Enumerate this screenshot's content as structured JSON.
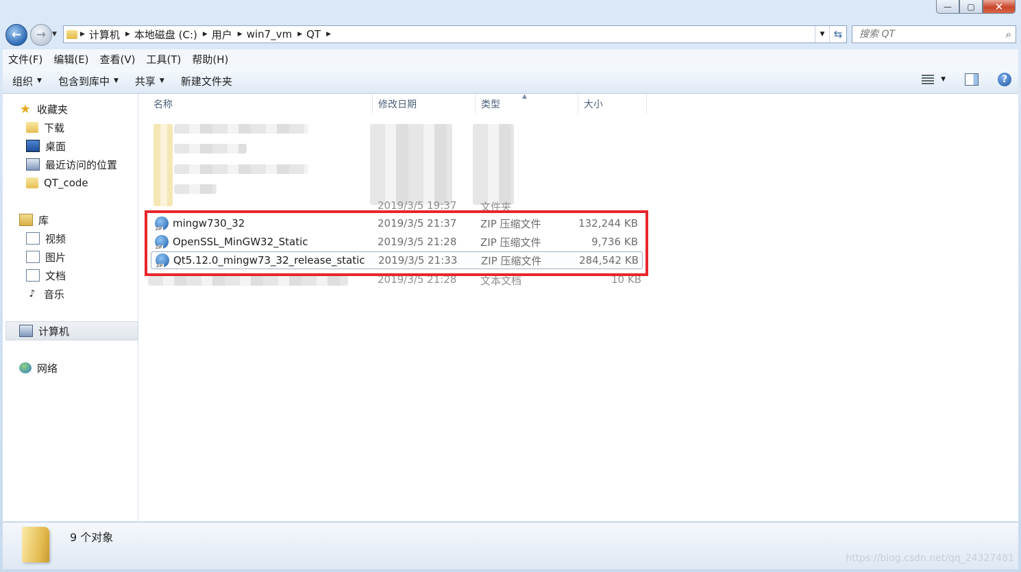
{
  "window": {
    "controls": {
      "minimize": "—",
      "maximize": "▢",
      "close": "✕"
    }
  },
  "address": {
    "crumbs": [
      "计算机",
      "本地磁盘 (C:)",
      "用户",
      "win7_vm",
      "QT"
    ],
    "search_placeholder": "搜索 QT"
  },
  "menu": [
    "文件(F)",
    "编辑(E)",
    "查看(V)",
    "工具(T)",
    "帮助(H)"
  ],
  "toolbar": {
    "organize": "组织",
    "include_library": "包含到库中",
    "share": "共享",
    "new_folder": "新建文件夹"
  },
  "nav": {
    "favorites": "收藏夹",
    "downloads": "下载",
    "desktop": "桌面",
    "recent": "最近访问的位置",
    "qt_code": "QT_code",
    "libraries": "库",
    "videos": "视频",
    "pictures": "图片",
    "documents": "文档",
    "music": "音乐",
    "computer": "计算机",
    "network": "网络"
  },
  "columns": {
    "name": "名称",
    "date": "修改日期",
    "type": "类型",
    "size": "大小"
  },
  "files": [
    {
      "name": "mingw730_32",
      "date": "2019/3/5 21:37",
      "type": "ZIP 压缩文件",
      "size": "132,244 KB"
    },
    {
      "name": "OpenSSL_MinGW32_Static",
      "date": "2019/3/5 21:28",
      "type": "ZIP 压缩文件",
      "size": "9,736 KB"
    },
    {
      "name": "Qt5.12.0_mingw73_32_release_static",
      "date": "2019/3/5 21:33",
      "type": "ZIP 压缩文件",
      "size": "284,542 KB"
    }
  ],
  "partial_rows": {
    "above": {
      "date": "2019/3/5 19:37",
      "type": "文件夹"
    },
    "below": {
      "date": "2019/3/5 21:28",
      "type": "文本文档",
      "size": "10 KB"
    }
  },
  "status": {
    "count": "9 个对象"
  },
  "watermark": "https://blog.csdn.net/qq_24327481",
  "colors": {
    "highlight_box": "#e8262b"
  }
}
